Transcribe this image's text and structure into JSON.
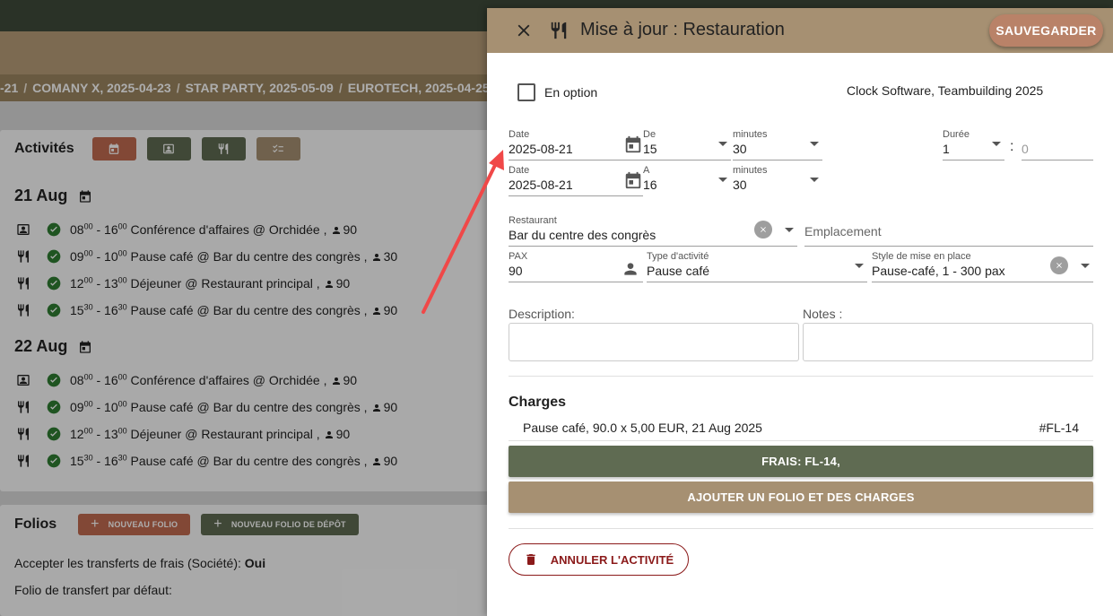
{
  "colors": {
    "top_bar": "#3e4a3a",
    "brand_tan": "#a69072",
    "olive": "#5f6b52",
    "rust": "#c06a50",
    "save_button": "#b98268",
    "danger": "#8b1a1a",
    "success": "#2e7d32",
    "annotation_arrow": "#f04848"
  },
  "breadcrumbs": [
    "-21",
    "COMANY X, 2025-04-23",
    "STAR PARTY, 2025-05-09",
    "EUROTECH, 2025-04-25"
  ],
  "breadcrumb_separator": "/",
  "activities": {
    "title": "Activités",
    "toolbar_icons": [
      "calendar-icon",
      "presentation-icon",
      "fork-knife-icon",
      "checklist-icon"
    ],
    "days": [
      {
        "label": "21 Aug",
        "items": [
          {
            "icon": "presentation-icon",
            "start_h": "08",
            "start_m": "00",
            "end_h": "16",
            "end_m": "00",
            "text": "Conférence d'affaires @ Orchidée ,",
            "pax": "90"
          },
          {
            "icon": "fork-knife-icon",
            "start_h": "09",
            "start_m": "00",
            "end_h": "10",
            "end_m": "00",
            "text": "Pause café @ Bar du centre des congrès ,",
            "pax": "30"
          },
          {
            "icon": "fork-knife-icon",
            "start_h": "12",
            "start_m": "00",
            "end_h": "13",
            "end_m": "00",
            "text": "Déjeuner @ Restaurant principal ,",
            "pax": "90"
          },
          {
            "icon": "fork-knife-icon",
            "start_h": "15",
            "start_m": "30",
            "end_h": "16",
            "end_m": "30",
            "text": "Pause café @ Bar du centre des congrès ,",
            "pax": "90"
          }
        ]
      },
      {
        "label": "22 Aug",
        "items": [
          {
            "icon": "presentation-icon",
            "start_h": "08",
            "start_m": "00",
            "end_h": "16",
            "end_m": "00",
            "text": "Conférence d'affaires @ Orchidée ,",
            "pax": "90"
          },
          {
            "icon": "fork-knife-icon",
            "start_h": "09",
            "start_m": "00",
            "end_h": "10",
            "end_m": "00",
            "text": "Pause café @ Bar du centre des congrès ,",
            "pax": "90"
          },
          {
            "icon": "fork-knife-icon",
            "start_h": "12",
            "start_m": "00",
            "end_h": "13",
            "end_m": "00",
            "text": "Déjeuner @ Restaurant principal ,",
            "pax": "90"
          },
          {
            "icon": "fork-knife-icon",
            "start_h": "15",
            "start_m": "30",
            "end_h": "16",
            "end_m": "30",
            "text": "Pause café @ Bar du centre des congrès ,",
            "pax": "90"
          }
        ]
      }
    ]
  },
  "folios": {
    "title": "Folios",
    "new_folio": "NOUVEAU FOLIO",
    "new_deposit_folio": "NOUVEAU FOLIO DE DÉPÔT",
    "accept_transfers_label": "Accepter les transferts de frais (Société):",
    "accept_transfers_value": "Oui",
    "default_transfer_label": "Folio de transfert par défaut:"
  },
  "drawer": {
    "title": "Mise à jour : Restauration",
    "save": "SAUVEGARDER",
    "option_label": "En option",
    "client": "Clock Software, Teambuilding 2025",
    "start": {
      "date_label": "Date",
      "date": "2025-08-21",
      "hour_label": "De",
      "hour": "15",
      "min_label": "minutes",
      "min": "30"
    },
    "end": {
      "date_label": "Date",
      "date": "2025-08-21",
      "hour_label": "A",
      "hour": "16",
      "min_label": "minutes",
      "min": "30"
    },
    "duration": {
      "label": "Durée",
      "hours": "1",
      "separator": ":",
      "minutes_placeholder": "0"
    },
    "restaurant": {
      "label": "Restaurant",
      "value": "Bar du centre des congrès"
    },
    "location_placeholder": "Emplacement",
    "pax": {
      "label": "PAX",
      "value": "90"
    },
    "activity_type": {
      "label": "Type d'activité",
      "value": "Pause café"
    },
    "setup_style": {
      "label": "Style de mise en place",
      "value": "Pause-café, 1 - 300 pax"
    },
    "description_label": "Description:",
    "notes_label": "Notes :",
    "charges": {
      "title": "Charges",
      "rows": [
        {
          "desc": "Pause café, 90.0 x 5,00 EUR, 21 Aug 2025",
          "ref": "#FL-14"
        }
      ],
      "fees_button": "FRAIS: FL-14,",
      "add_button": "AJOUTER UN FOLIO ET DES CHARGES"
    },
    "cancel": "ANNULER L'ACTIVITÉ"
  }
}
